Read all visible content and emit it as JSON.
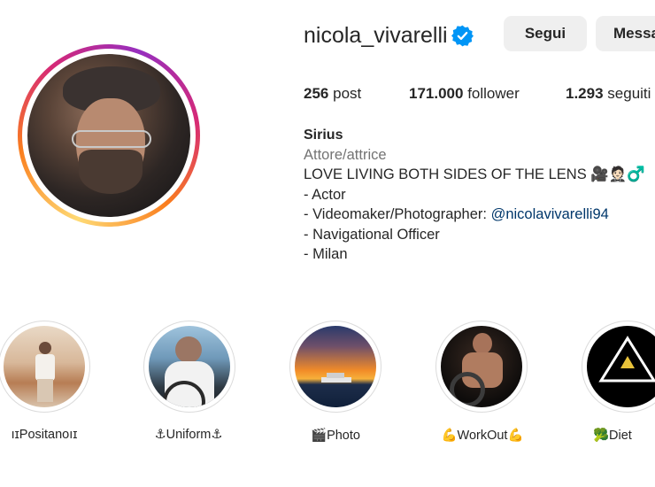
{
  "profile": {
    "username": "nicola_vivarelli",
    "follow_label": "Segui",
    "message_label": "Messa"
  },
  "stats": {
    "posts_value": "256",
    "posts_label": "post",
    "followers_value": "171.000",
    "followers_label": "follower",
    "following_value": "1.293",
    "following_label": "seguiti"
  },
  "bio": {
    "name": "Sirius",
    "category": "Attore/attrice",
    "line1": "LOVE LIVING BOTH SIDES OF THE LENS 🎥🤵🏻♂️",
    "line2": "- Actor",
    "line3_prefix": "- Videomaker/Photographer: ",
    "line3_link": "@nicolavivarelli94",
    "line4": "- Navigational Officer",
    "line5": "- Milan"
  },
  "highlights": [
    {
      "label": "ıɪPositanoıɪ"
    },
    {
      "label": "⚓Uniform⚓"
    },
    {
      "label": "🎬Photo"
    },
    {
      "label": "💪WorkOut💪"
    },
    {
      "label": "🥦Diet"
    }
  ],
  "icons": {
    "verified": "verified-badge-icon"
  },
  "colors": {
    "verified_blue": "#0095f6",
    "link_blue": "#00376b",
    "button_bg": "#efefef",
    "category_gray": "#737373"
  }
}
